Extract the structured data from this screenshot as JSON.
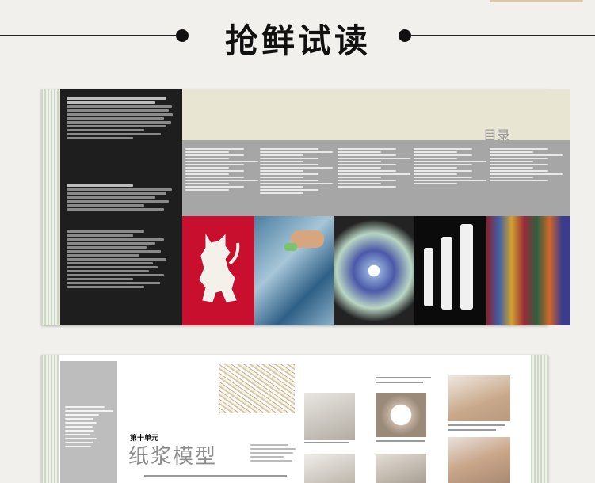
{
  "page_title": "抢鲜试读",
  "spread1": {
    "contents_heading": "目录"
  },
  "spread2": {
    "unit_label": "第十单元",
    "chapter_title": "纸浆模型"
  }
}
